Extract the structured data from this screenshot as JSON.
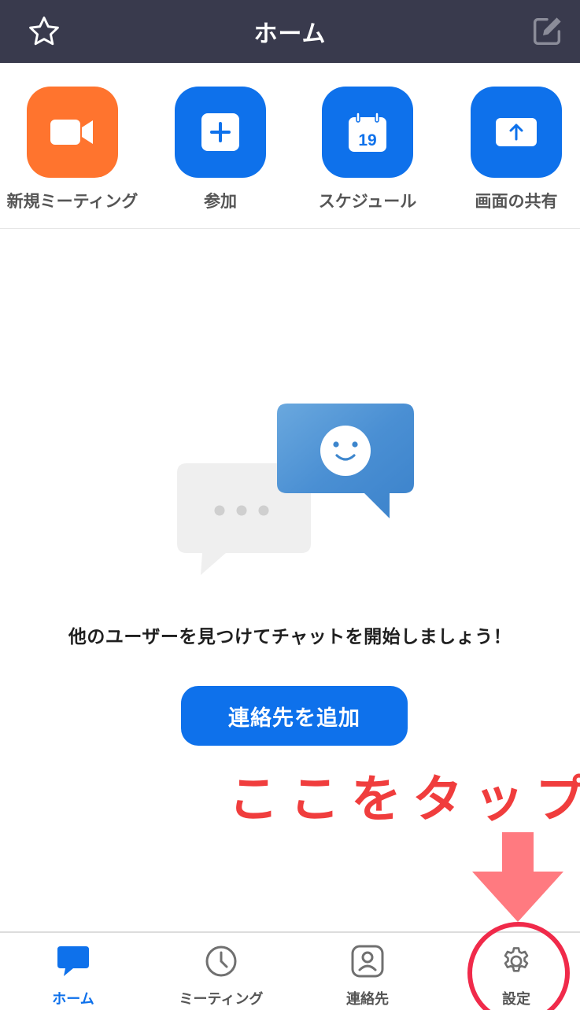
{
  "header": {
    "title": "ホーム",
    "left_icon": "star-icon",
    "right_icon": "edit-icon"
  },
  "actions": [
    {
      "label": "新規ミーティング",
      "icon": "video-camera-icon",
      "color": "#ff742e"
    },
    {
      "label": "参加",
      "icon": "plus-icon",
      "color": "#0e71eb"
    },
    {
      "label": "スケジュール",
      "icon": "calendar-icon",
      "color": "#0e71eb",
      "calendar_day": "19"
    },
    {
      "label": "画面の共有",
      "icon": "share-screen-icon",
      "color": "#0e71eb"
    }
  ],
  "empty_state": {
    "message": "他のユーザーを見つけてチャットを開始しましょう！",
    "button_label": "連絡先を追加"
  },
  "annotation": {
    "text": "ここをタップ",
    "color": "#f03d3d"
  },
  "tabs": [
    {
      "label": "ホーム",
      "icon": "chat-bubble-icon",
      "active": true
    },
    {
      "label": "ミーティング",
      "icon": "clock-icon",
      "active": false
    },
    {
      "label": "連絡先",
      "icon": "contact-icon",
      "active": false
    },
    {
      "label": "設定",
      "icon": "gear-icon",
      "active": false
    }
  ],
  "colors": {
    "header_bg": "#393a4d",
    "accent": "#0e71eb",
    "orange": "#ff742e"
  }
}
